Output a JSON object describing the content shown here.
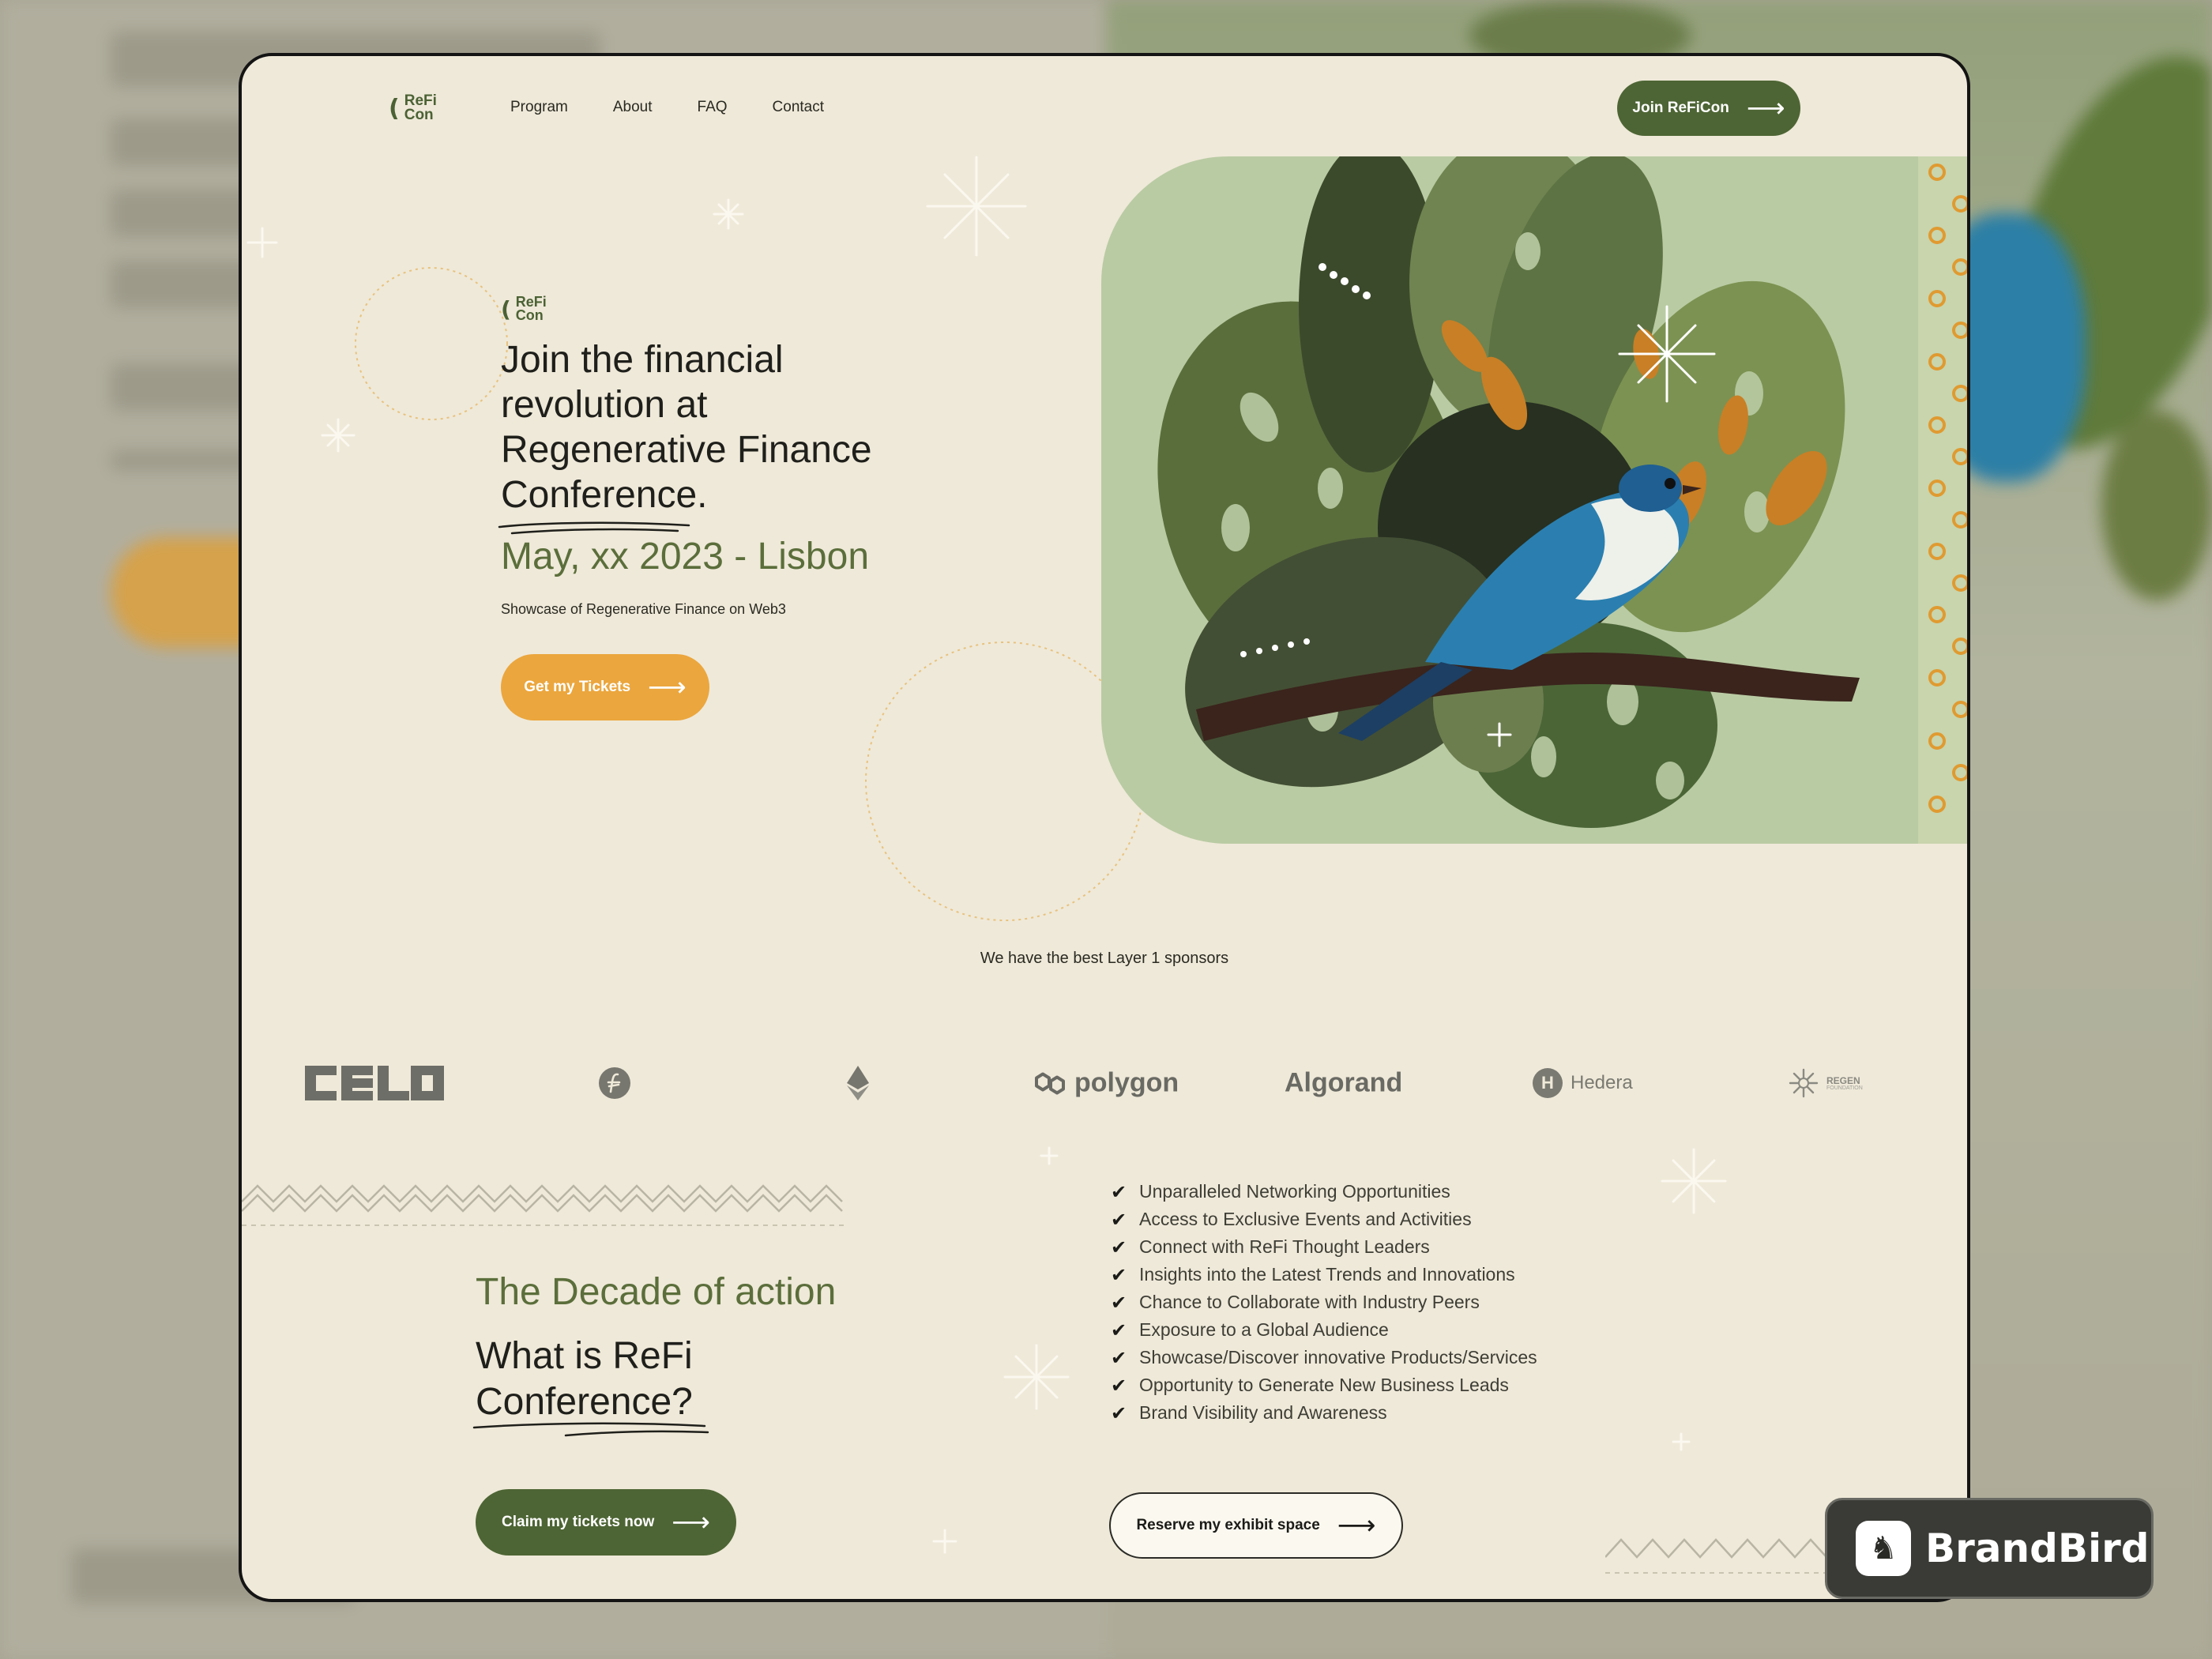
{
  "nav": {
    "logo": {
      "mark": "(",
      "line1": "ReFi",
      "line2": "Con"
    },
    "links": [
      "Program",
      "About",
      "FAQ",
      "Contact"
    ],
    "cta": "Join ReFiCon"
  },
  "hero": {
    "logo": {
      "mark": "(",
      "line1": "ReFi",
      "line2": "Con"
    },
    "title_lines": [
      "Join the financial",
      "revolution at",
      "Regenerative Finance",
      "Conference."
    ],
    "date": "May, xx 2023 - Lisbon",
    "subtitle": "Showcase of Regenerative Finance on Web3",
    "cta": "Get my Tickets"
  },
  "sponsors": {
    "title": "We have the best Layer 1 sponsors",
    "items": [
      {
        "name": "celo",
        "label": "celo"
      },
      {
        "name": "filecoin",
        "label": ""
      },
      {
        "name": "ethereum",
        "label": ""
      },
      {
        "name": "polygon",
        "label": "polygon"
      },
      {
        "name": "algorand",
        "label": "Algorand"
      },
      {
        "name": "hedera",
        "label": "Hedera",
        "glyph": "H"
      },
      {
        "name": "regen",
        "label": "REGEN",
        "sub": "FOUNDATION"
      }
    ]
  },
  "about": {
    "kicker": "The Decade of action",
    "title_lines": [
      "What is ReFi",
      "Conference?"
    ],
    "cta": "Claim my tickets now"
  },
  "benefits": {
    "items": [
      "Unparalleled Networking Opportunities",
      "Access to Exclusive Events and Activities",
      "Connect with ReFi Thought Leaders",
      "Insights into the Latest Trends and Innovations",
      "Chance to Collaborate with Industry Peers",
      "Exposure to a Global Audience",
      "Showcase/Discover innovative Products/Services",
      "Opportunity to Generate New Business Leads",
      "Brand Visibility and Awareness"
    ],
    "cta": "Reserve my exhibit space"
  },
  "watermark": {
    "text": "BrandBird"
  },
  "colors": {
    "page_bg": "#efe9d9",
    "accent_green": "#4d6534",
    "accent_orange": "#eba63d",
    "text_dark": "#1f1f1b",
    "bird_blue": "#2a7fb0"
  },
  "icons": {
    "arrow": "arrow-right-icon",
    "check": "check-icon",
    "logo": "refi-con-logo"
  }
}
